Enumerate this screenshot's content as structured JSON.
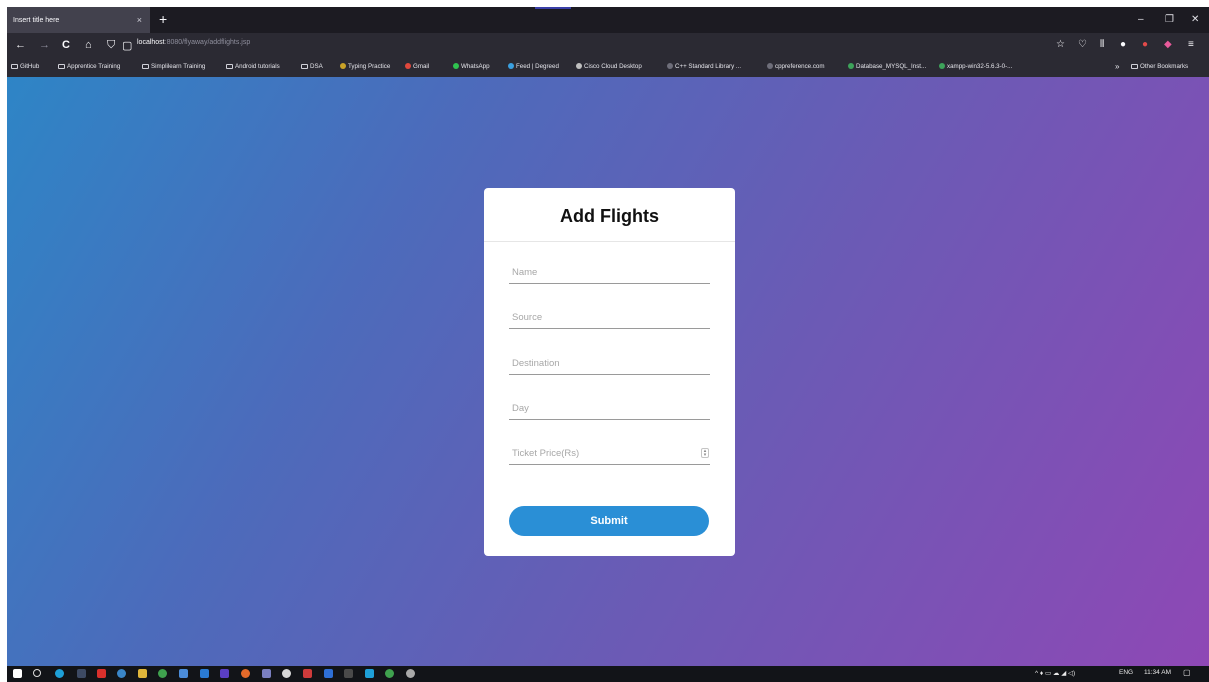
{
  "browser": {
    "tab_title": "Insert title here",
    "tab_close": "×",
    "new_tab": "+",
    "window_controls": {
      "minimize": "–",
      "restore": "❐",
      "close": "✕"
    },
    "nav": {
      "back": "←",
      "forward": "→",
      "reload": "C",
      "home": "⌂"
    },
    "url_host": "localhost",
    "url_path": ":8080/flyaway/addflights.jsp",
    "bookmarks": [
      "GitHub",
      "Apprentice Training",
      "Simplilearn Training",
      "Android tutorials",
      "DSA",
      "Typing Practice",
      "Gmail",
      "WhatsApp",
      "Feed | Degreed",
      "Cisco Cloud Desktop",
      "C++ Standard Library ...",
      "cppreference.com",
      "Database_MYSQL_Inst...",
      "xampp-win32-5.6.3-0-..."
    ],
    "bookmarks_more": "»",
    "other_bookmarks": "Other Bookmarks"
  },
  "form": {
    "title": "Add Flights",
    "name_placeholder": "Name",
    "source_placeholder": "Source",
    "destination_placeholder": "Destination",
    "day_placeholder": "Day",
    "price_placeholder": "Ticket Price(Rs)",
    "submit_label": "Submit"
  },
  "taskbar": {
    "language": "ENG",
    "time": "11:34 AM"
  },
  "colors": {
    "gradient_start": "#2e85c6",
    "gradient_end": "#8e48b5",
    "submit": "#2a8fd6"
  }
}
